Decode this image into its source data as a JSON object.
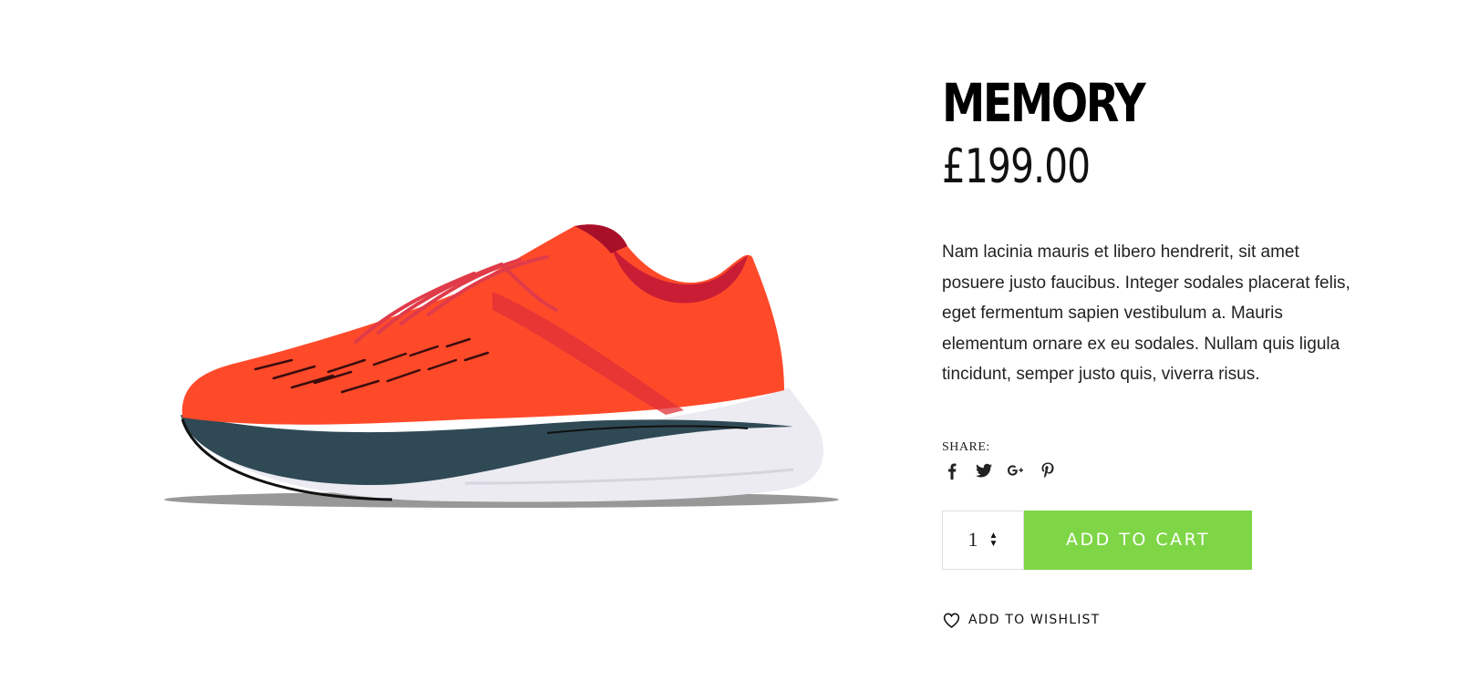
{
  "product": {
    "title": "MEMORY",
    "price": "£199.00",
    "description": "Nam lacinia mauris et libero hendrerit, sit amet posuere justo faucibus. Integer sodales placerat felis, eget fermentum sapien vestibulum a. Mauris elementum ornare ex eu sodales. Nullam quis ligula tincidunt, semper justo quis, viverra risus.",
    "image_icon": "running-shoe-image"
  },
  "share": {
    "label": "SHARE:",
    "icons": [
      "facebook-icon",
      "twitter-icon",
      "google-plus-icon",
      "pinterest-icon"
    ]
  },
  "purchase": {
    "quantity": "1",
    "add_to_cart_label": "ADD TO CART",
    "accent_color": "#7ed647"
  },
  "wishlist": {
    "label": "ADD TO WISHLIST",
    "icon": "heart-icon"
  }
}
